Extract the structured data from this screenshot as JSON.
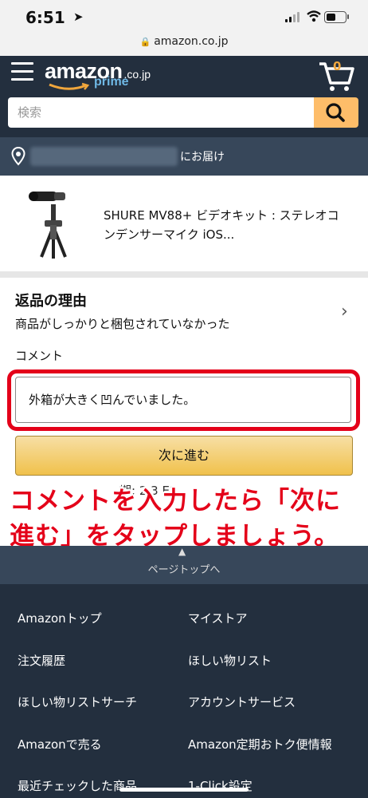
{
  "status_bar": {
    "time": "6:51"
  },
  "browser": {
    "url": "amazon.co.jp"
  },
  "header": {
    "logo_text": "amazon",
    "logo_tld": ".co.jp",
    "logo_sub": "prime",
    "cart_count": "0",
    "search_placeholder": "検索",
    "deliver_to_suffix": "にお届け"
  },
  "product": {
    "title": "SHURE MV88+ ビデオキット : ステレオコンデンサーマイク iOS..."
  },
  "return_form": {
    "reason_heading": "返品の理由",
    "reason_value": "商品がしっかりと梱包されていなかった",
    "comment_label": "コメント",
    "comment_value": "外箱が大きく凹んでいました。",
    "next_button": "次に進む",
    "partial_hidden_text": "期: 2 3 E2"
  },
  "annotation": {
    "text_line1": "コメントを入力したら「次に",
    "text_line2": "進む」をタップしましょう。"
  },
  "footer": {
    "page_top": "ページトップへ",
    "links_left": [
      "Amazonトップ",
      "注文履歴",
      "ほしい物リストサーチ",
      "Amazonで売る",
      "最近チェックした商品"
    ],
    "links_right": [
      "マイストア",
      "ほしい物リスト",
      "アカウントサービス",
      "Amazon定期おトク便情報",
      "1-Click設定"
    ]
  },
  "colors": {
    "header_bg": "#232f3e",
    "subheader_bg": "#37475a",
    "accent": "#febd69",
    "annotation_red": "#e40019"
  }
}
